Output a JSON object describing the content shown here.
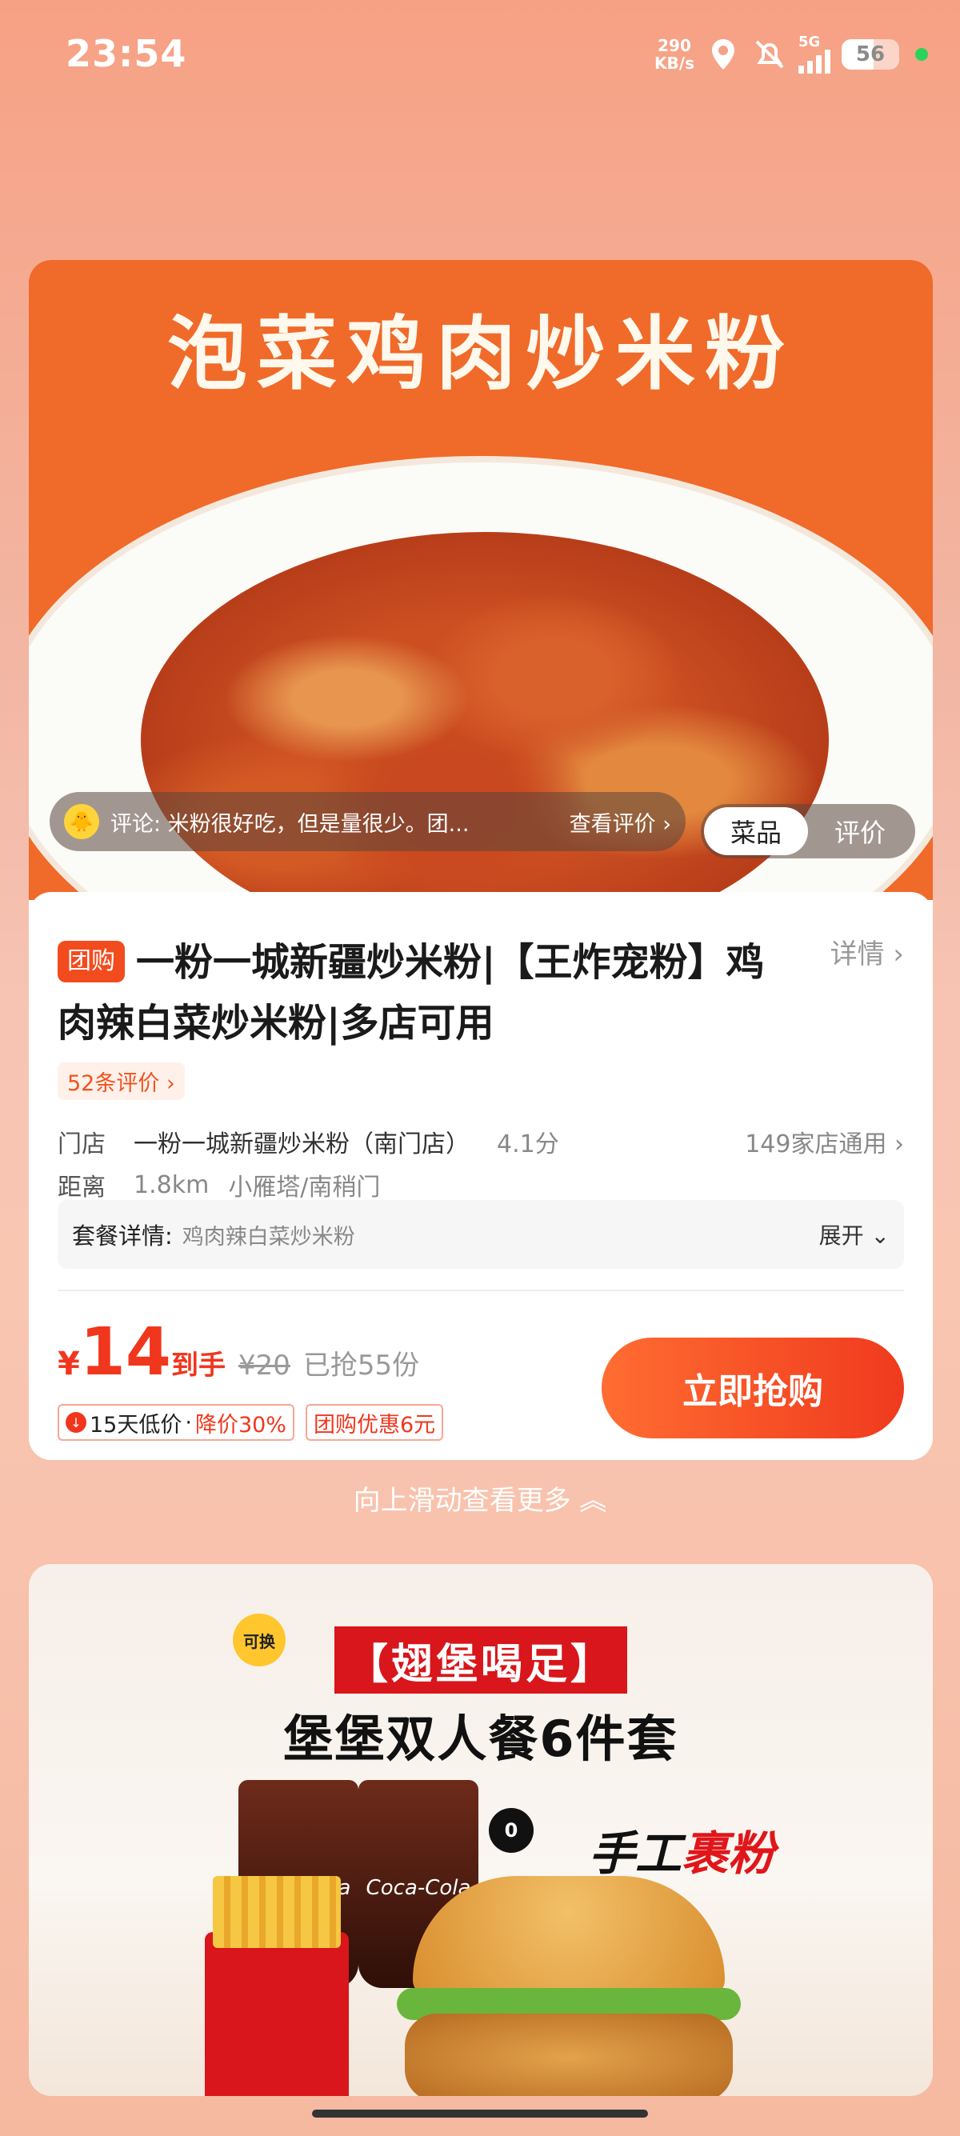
{
  "status_bar": {
    "time": "23:54",
    "net_speed_value": "290",
    "net_speed_unit": "KB/s",
    "network": "5G",
    "battery": "56",
    "icons": [
      "location-icon",
      "mute-icon",
      "signal-icon",
      "battery-icon"
    ]
  },
  "product": {
    "hero_title": "泡菜鸡肉炒米粉",
    "review_preview": "评论: 米粉很好吃，但是量很少。团...",
    "review_link": "查看评价 ›",
    "segments": [
      "菜品",
      "评价"
    ],
    "group_tag": "团购",
    "title": "一粉一城新疆炒米粉|【王炸宠粉】鸡肉辣白菜炒米粉|多店可用",
    "details_link": "详情 ›",
    "reviews_count": "52条评价 ›",
    "store_label": "门店",
    "store_name": "一粉一城新疆炒米粉（南门店）",
    "store_score": "4.1分",
    "store_count": "149家店通用 ›",
    "distance_label": "距离",
    "distance": "1.8km",
    "area": "小雁塔/南稍门",
    "package_label": "套餐详情:",
    "package_value": "鸡肉辣白菜炒米粉",
    "expand_label": "展开 ⌄",
    "currency": "¥",
    "price": "14",
    "price_suffix": "到手",
    "original_price": "¥20",
    "sold": "已抢55份",
    "chip_low_price": "15天低价",
    "chip_discount": "降价30%",
    "chip_coupon": "团购优惠6元",
    "buy_button": "立即抢购"
  },
  "scroll_hint": "向上滑动查看更多 ︽",
  "promo": {
    "tag": "【翅堡喝足】",
    "title": "堡堡双人餐6件套",
    "cup_label": "Coca-Cola",
    "badge_swap": "可换",
    "badge_zero": "0",
    "handwrite_1": "手工",
    "handwrite_2": "裹粉"
  },
  "colors": {
    "accent": "#f03a1e",
    "group_tag": "#f24b1e",
    "promo_red": "#d8161b"
  }
}
